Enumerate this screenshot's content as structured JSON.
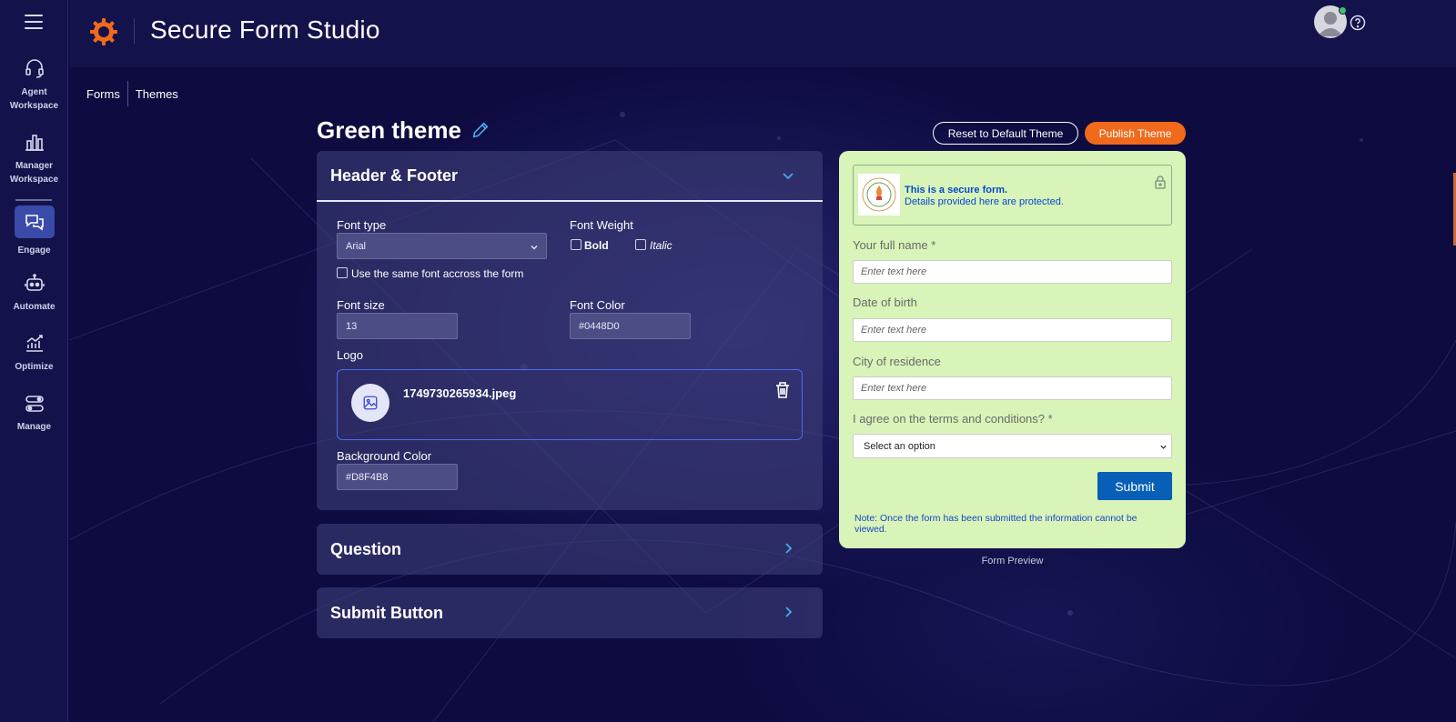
{
  "app": {
    "title": "Secure Form Studio"
  },
  "sidebar": {
    "items": [
      {
        "label": "Agent Workspace",
        "icon": "headset-icon"
      },
      {
        "label": "Manager Workspace",
        "icon": "bar-chart-icon"
      },
      {
        "label": "Engage",
        "icon": "chat-bubbles-icon",
        "active": true
      },
      {
        "label": "Automate",
        "icon": "robot-icon"
      },
      {
        "label": "Optimize",
        "icon": "trend-chart-icon"
      },
      {
        "label": "Manage",
        "icon": "toggles-icon"
      }
    ]
  },
  "breadcrumb": {
    "forms": "Forms",
    "themes": "Themes"
  },
  "page": {
    "title": "Green theme",
    "reset_label": "Reset to Default Theme",
    "publish_label": "Publish Theme"
  },
  "header_footer": {
    "title": "Header & Footer",
    "font_type_label": "Font type",
    "font_type_value": "Arial",
    "same_font_label": "Use the same font accross the form",
    "font_weight_label": "Font Weight",
    "bold_label": "Bold",
    "italic_label": "Italic",
    "font_size_label": "Font size",
    "font_size_value": "13",
    "font_color_label": "Font Color",
    "font_color_value": "#0448D0",
    "logo_label": "Logo",
    "logo_file": "1749730265934.jpeg",
    "bg_color_label": "Background Color",
    "bg_color_value": "#D8F4B8"
  },
  "sections": {
    "question": "Question",
    "submit_button": "Submit Button"
  },
  "preview": {
    "secure_title": "This is a secure form.",
    "secure_sub": "Details provided here are protected.",
    "q1": "Your full name *",
    "q2": "Date of birth",
    "q3": "City of residence",
    "q4": "I agree on the terms and conditions? *",
    "placeholder": "Enter text here",
    "select_placeholder": "Select an option",
    "submit": "Submit",
    "note": "Note: Once the form has been submitted the information cannot be viewed.",
    "caption": "Form Preview"
  },
  "colors": {
    "accent": "#f06a1c",
    "form_font": "#0448D0",
    "form_bg": "#D8F4B8",
    "submit": "#075fb8"
  }
}
